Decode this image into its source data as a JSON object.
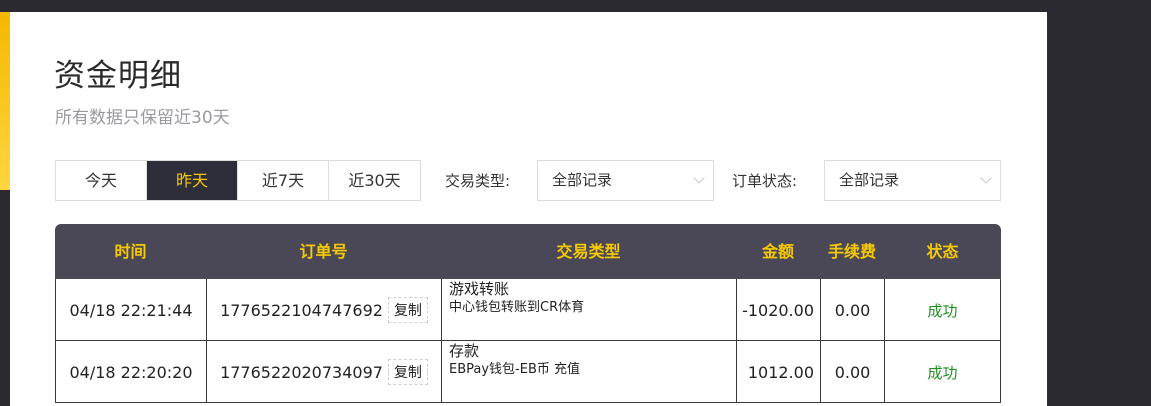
{
  "page": {
    "title": "资金明细",
    "subtitle": "所有数据只保留近30天"
  },
  "tabs": [
    {
      "label": "今天",
      "active": false
    },
    {
      "label": "昨天",
      "active": true
    },
    {
      "label": "近7天",
      "active": false
    },
    {
      "label": "近30天",
      "active": false
    }
  ],
  "filters": {
    "trade_type": {
      "label": "交易类型:",
      "value": "全部记录"
    },
    "order_status": {
      "label": "订单状态:",
      "value": "全部记录"
    }
  },
  "table": {
    "headers": [
      "时间",
      "订单号",
      "交易类型",
      "金额",
      "手续费",
      "状态"
    ],
    "copy_label": "复制",
    "rows": [
      {
        "time": "04/18 22:21:44",
        "order_no": "1776522104747692",
        "type_main": "游戏转账",
        "type_sub": "中心钱包转账到CR体育",
        "amount": "-1020.00",
        "fee": "0.00",
        "status": "成功"
      },
      {
        "time": "04/18 22:20:20",
        "order_no": "1776522020734097",
        "type_main": "存款",
        "type_sub": "EBPay钱包-EB币 充值",
        "amount": "1012.00",
        "fee": "0.00",
        "status": "成功"
      }
    ]
  },
  "colors": {
    "accent": "#f7c900",
    "header_bg": "#4a4856",
    "active_tab_bg": "#2e2d3a",
    "success": "#1f8f22"
  }
}
